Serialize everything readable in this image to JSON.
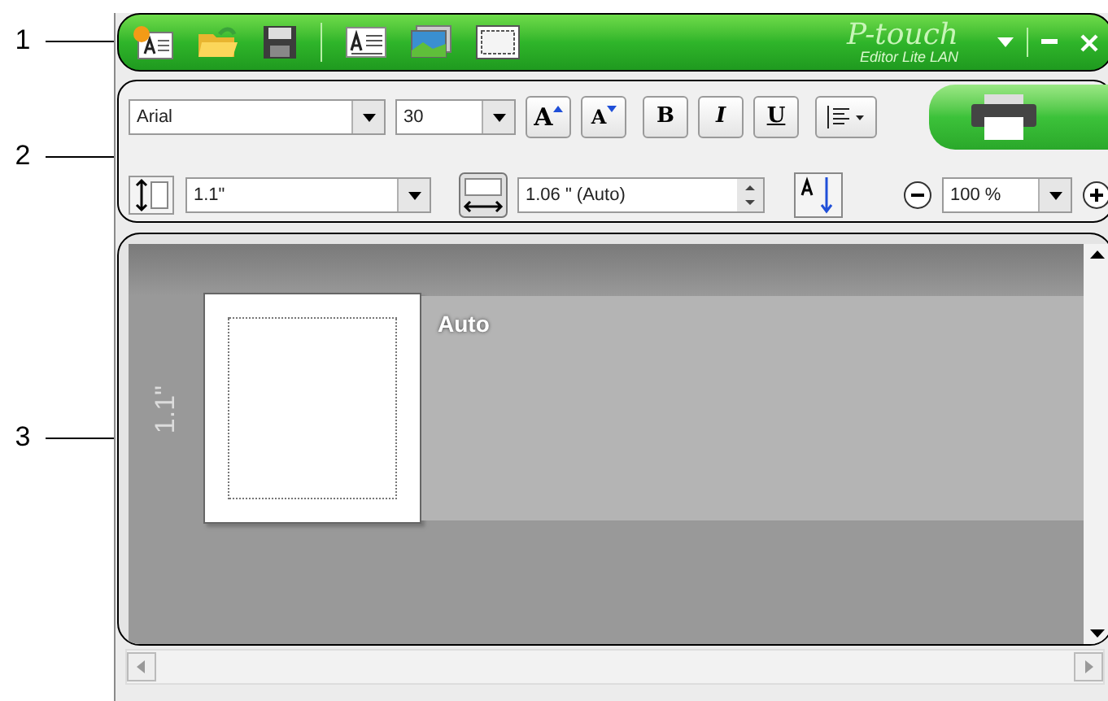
{
  "callouts": [
    "1",
    "2",
    "3"
  ],
  "title_bar": {
    "logo": "P-touch",
    "logo_subtitle": "Editor Lite LAN"
  },
  "toolbar": {
    "font": "Arial",
    "font_size": "30",
    "grow_font": "A",
    "shrink_font": "A",
    "bold": "B",
    "italic": "I",
    "underline": "U",
    "tape_length": "1.1\"",
    "label_width": "1.06 \" (Auto)",
    "zoom": "100 %"
  },
  "canvas": {
    "length_label": "1.1\"",
    "mode_label": "Auto"
  }
}
